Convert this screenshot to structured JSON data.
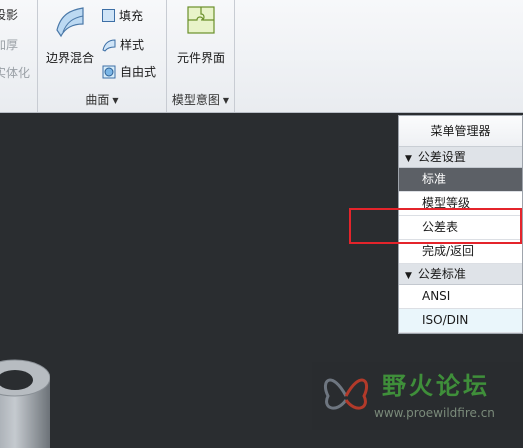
{
  "ribbon": {
    "left_group": {
      "items": [
        "设影",
        "加厚",
        "实体化"
      ]
    },
    "surfaces_group": {
      "label": "曲面",
      "boundary_blend": "边界混合",
      "fill": "填充",
      "style": "样式",
      "freeform": "自由式"
    },
    "model_intent_group": {
      "label": "模型意图",
      "component_interface": "元件界面"
    }
  },
  "menu_manager": {
    "title": "菜单管理器",
    "sections": [
      {
        "title": "公差设置",
        "items": [
          "标准",
          "模型等级",
          "公差表",
          "完成/返回"
        ]
      },
      {
        "title": "公差标准",
        "items": [
          "ANSI",
          "ISO/DIN"
        ]
      }
    ]
  },
  "watermark": {
    "title": "野火论坛",
    "url": "www.proewildfire.cn"
  },
  "colors": {
    "viewport_bg": "#2a2d30",
    "highlight": "#e4242b",
    "selected_item": "#5c6066"
  }
}
